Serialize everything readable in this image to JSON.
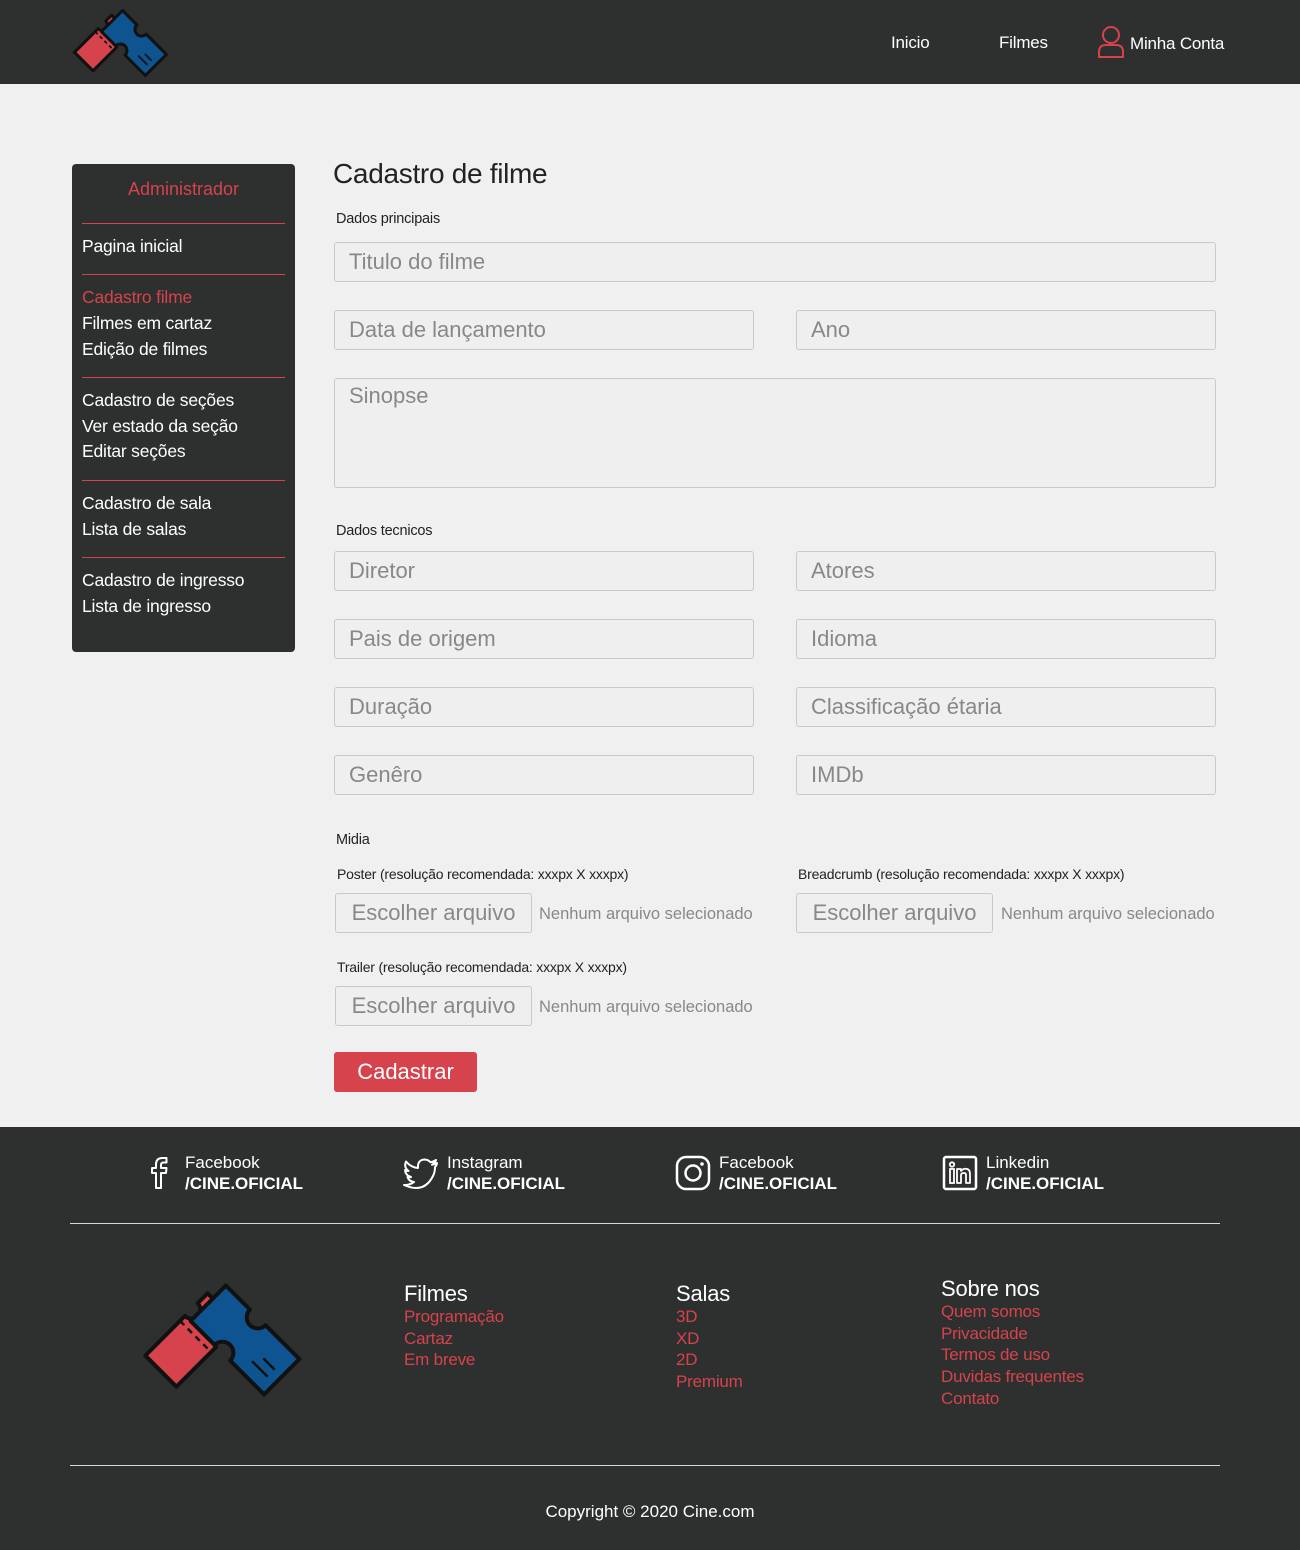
{
  "header": {
    "nav": [
      "Inicio",
      "Filmes"
    ],
    "account": "Minha Conta"
  },
  "sidebar": {
    "title": "Administrador",
    "groups": [
      [
        "Pagina inicial"
      ],
      [
        "Cadastro filme",
        "Filmes em cartaz",
        "Edição de filmes"
      ],
      [
        "Cadastro de seções",
        "Ver estado da seção",
        "Editar seções"
      ],
      [
        "Cadastro de sala",
        "Lista de salas"
      ],
      [
        "Cadastro de ingresso",
        "Lista de ingresso"
      ]
    ],
    "active": "Cadastro filme"
  },
  "form": {
    "title": "Cadastro de filme",
    "main_section": "Dados principais",
    "titulo_placeholder": "Titulo do filme",
    "data_placeholder": "Data de lançamento",
    "ano_placeholder": "Ano",
    "sinopse_placeholder": "Sinopse",
    "tech_section": "Dados tecnicos",
    "diretor_placeholder": "Diretor",
    "atores_placeholder": "Atores",
    "pais_placeholder": "Pais de origem",
    "idioma_placeholder": "Idioma",
    "duracao_placeholder": "Duração",
    "classificacao_placeholder": "Classificação étaria",
    "genero_placeholder": "Genêro",
    "imdb_placeholder": "IMDb",
    "media_section": "Midia",
    "poster_label": "Poster (resolução recomendada: xxxpx X xxxpx)",
    "breadcrumb_label": "Breadcrumb (resolução recomendada: xxxpx X xxxpx)",
    "trailer_label": "Trailer (resolução recomendada: xxxpx X xxxpx)",
    "file_button": "Escolher arquivo",
    "file_status": "Nenhum arquivo selecionado",
    "submit": "Cadastrar"
  },
  "footer": {
    "social": [
      {
        "icon": "facebook-icon",
        "name": "Facebook",
        "handle": "/CINE.OFICIAL"
      },
      {
        "icon": "twitter-icon",
        "name": "Instagram",
        "handle": "/CINE.OFICIAL"
      },
      {
        "icon": "instagram-icon",
        "name": "Facebook",
        "handle": "/CINE.OFICIAL"
      },
      {
        "icon": "linkedin-icon",
        "name": "Linkedin",
        "handle": "/CINE.OFICIAL"
      }
    ],
    "columns": [
      {
        "title": "Filmes",
        "links": [
          "Programação",
          "Cartaz",
          "Em breve"
        ]
      },
      {
        "title": "Salas",
        "links": [
          "3D",
          "XD",
          "2D",
          "Premium"
        ]
      },
      {
        "title": "Sobre nos",
        "links": [
          "Quem somos",
          "Privacidade",
          "Termos de uso",
          "Duvidas frequentes",
          "Contato"
        ]
      }
    ],
    "copyright": "Copyright © 2020 Cine.com"
  },
  "colors": {
    "dark": "#2e2f2f",
    "accent": "#d6434c",
    "blue": "#0d5490",
    "background": "#f0f0f0"
  }
}
